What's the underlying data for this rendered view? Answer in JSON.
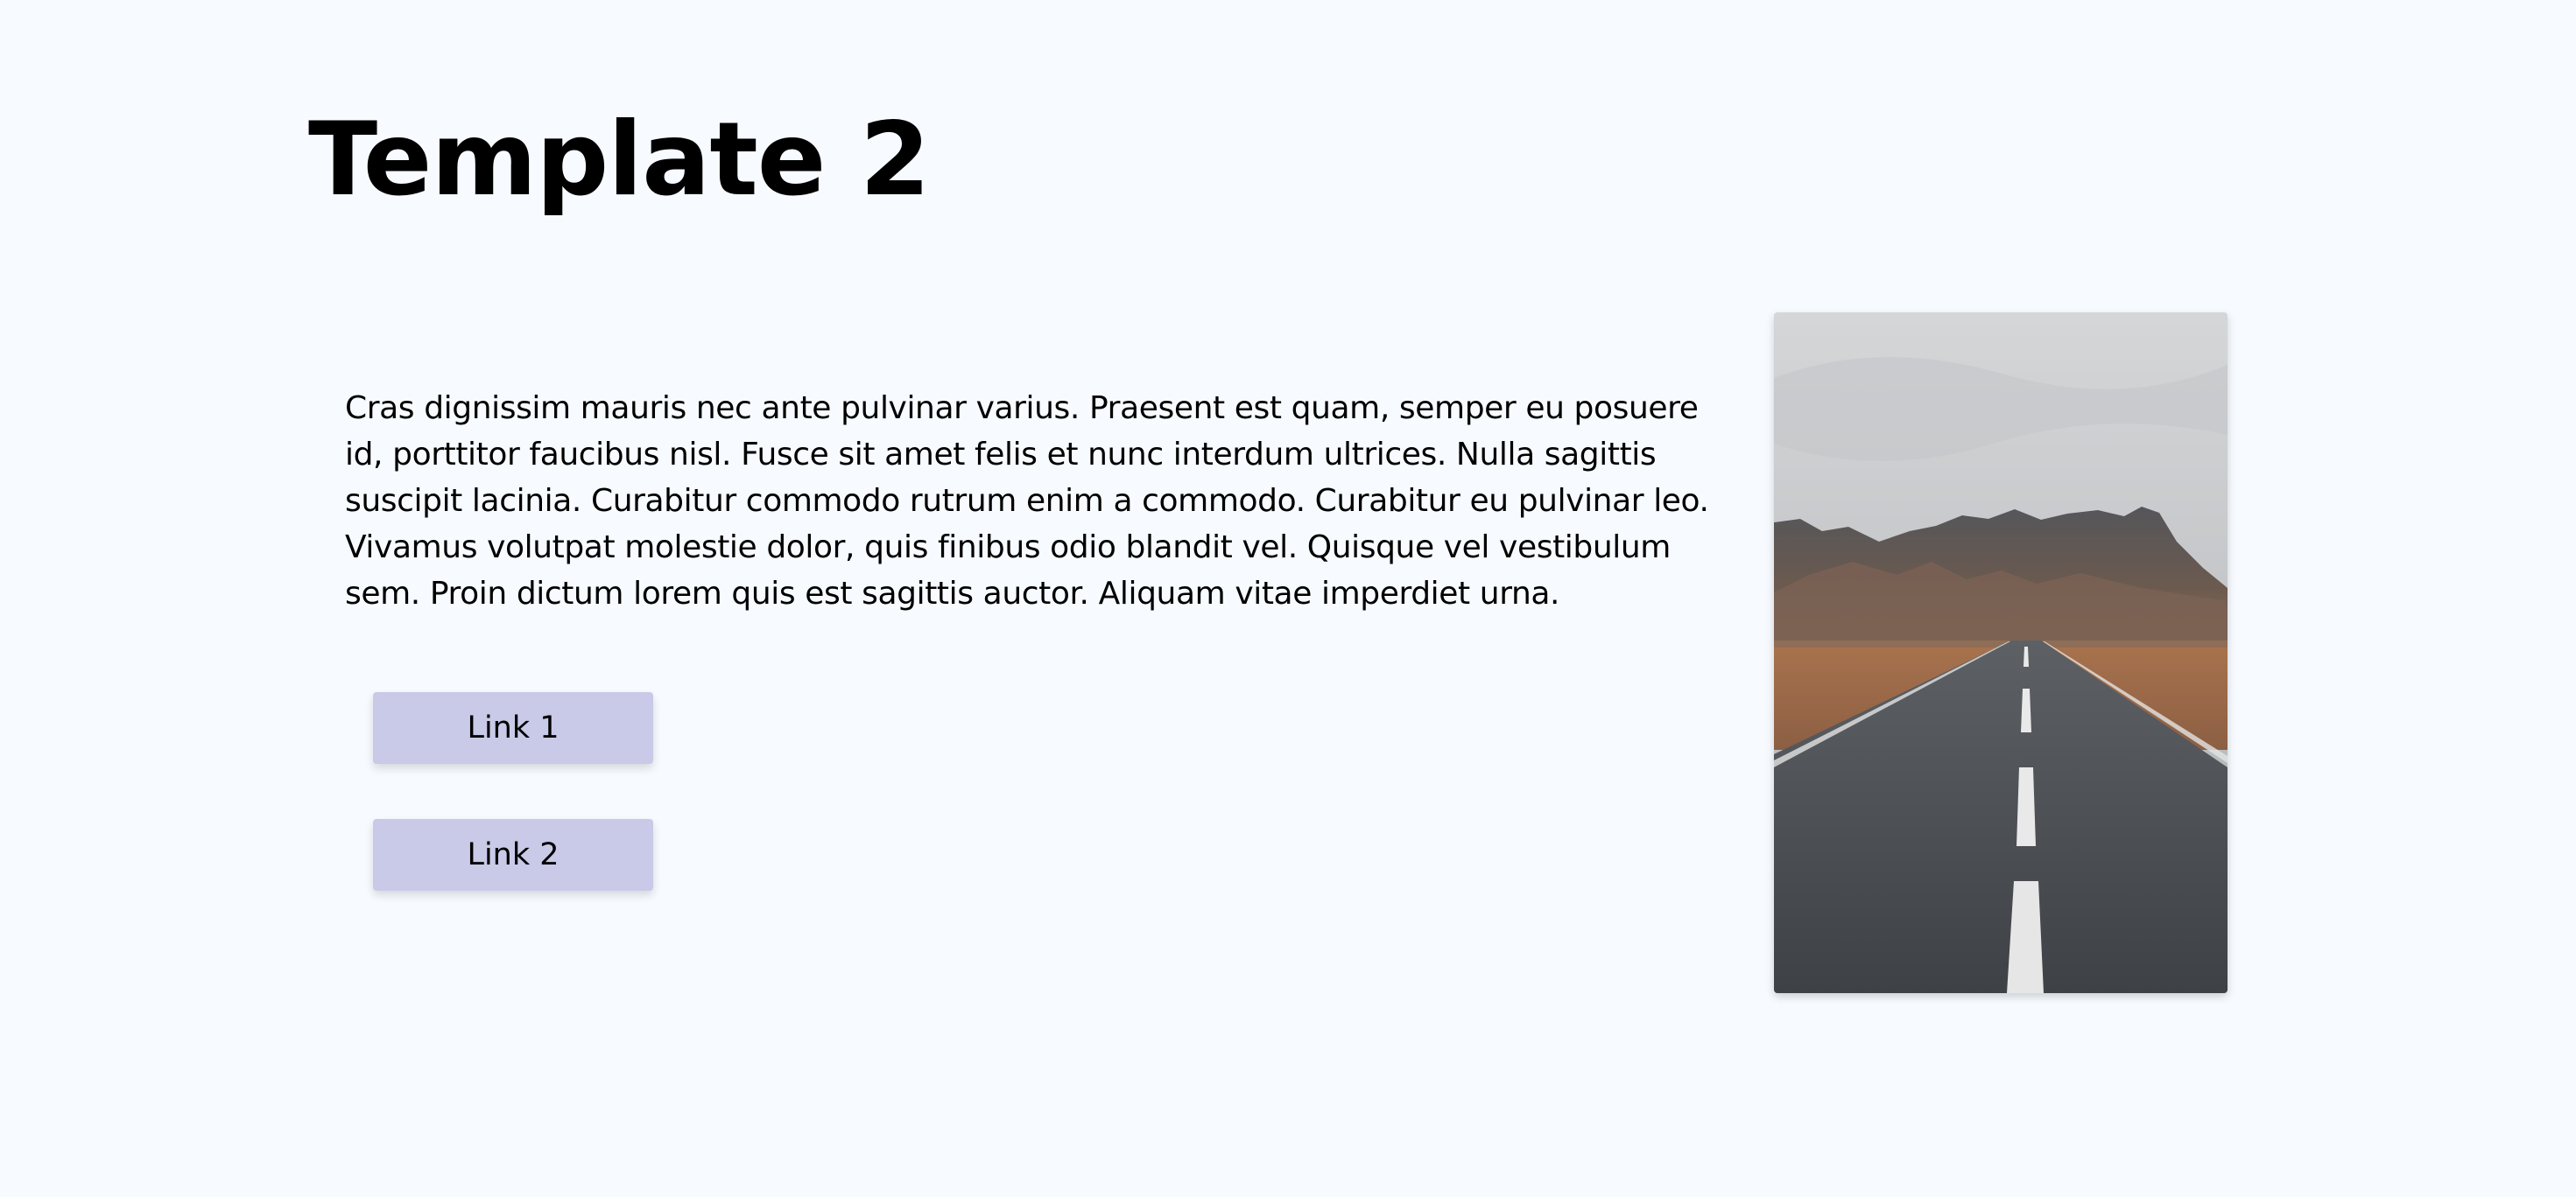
{
  "page": {
    "title": "Template 2",
    "paragraph": "Cras dignissim mauris nec ante pulvinar varius. Praesent est quam, semper eu posuere id, porttitor faucibus nisl. Fusce sit amet felis et nunc interdum ultrices. Nulla sagittis suscipit lacinia. Curabitur commodo rutrum enim a commodo. Curabitur eu pulvinar leo. Vivamus volutpat molestie dolor, quis finibus odio blandit vel. Quisque vel vestibulum sem. Proin dictum lorem quis est sagittis auctor. Aliquam vitae imperdiet urna."
  },
  "links": [
    {
      "label": "Link 1"
    },
    {
      "label": "Link 2"
    }
  ],
  "image": {
    "content": "road-through-mountains-photo"
  },
  "colors": {
    "background": "#f7fbff",
    "button": "#c9c9e8",
    "text": "#000000"
  }
}
